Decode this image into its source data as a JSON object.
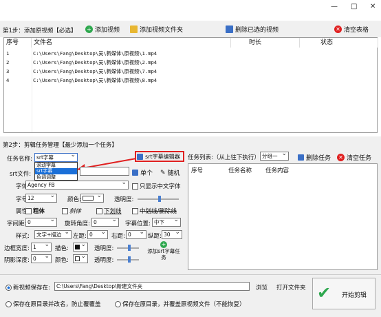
{
  "window": {
    "min": "—",
    "max": "□",
    "close": "✕"
  },
  "step1": {
    "title": "第1步：添加原视频【必选】",
    "add_video": "添加视频",
    "add_folder": "添加视频文件夹",
    "delete_selected": "删除已选的视频",
    "clear_table": "清空表格",
    "headers": [
      "序号",
      "文件名",
      "时长",
      "状态"
    ],
    "rows": [
      {
        "no": "1",
        "file": "C:\\Users\\Fang\\Desktop\\吴\\新媒体\\原视频\\1.mp4"
      },
      {
        "no": "2",
        "file": "C:\\Users\\Fang\\Desktop\\吴\\新媒体\\原视频\\2.mp4"
      },
      {
        "no": "3",
        "file": "C:\\Users\\Fang\\Desktop\\吴\\新媒体\\原视频\\7.mp4"
      },
      {
        "no": "4",
        "file": "C:\\Users\\Fang\\Desktop\\吴\\新媒体\\原视频\\8.mp4"
      }
    ]
  },
  "step2": {
    "title": "第2步：剪辑任务管理【最少添加一个任务】",
    "task_name_label": "任务名称:",
    "task_name_value": "srt字幕",
    "task_options": [
      "滚动字幕",
      "srt字幕",
      "色调调整"
    ],
    "srt_editor": "srt字幕编辑器",
    "srt_file_label": "srt文件:",
    "single": "单个",
    "random": "随机",
    "font_label": "字体:",
    "font_value": "Agency FB",
    "only_cn": "只显示中文字体",
    "size_label": "字号:",
    "size_value": "12",
    "color_label": "颜色:",
    "transparency_label": "透明度:",
    "attr_label": "属性:",
    "bold": "粗体",
    "italic": "斜体",
    "underline": "下划线",
    "strike": "中划线/删除线",
    "spacing_label": "字间距:",
    "spacing_value": "0",
    "rotate_label": "旋转角度:",
    "rotate_value": "0",
    "position_label": "字幕位置:",
    "position_value": "中下",
    "style_label": "样式:",
    "style_value": "文字+描边",
    "left_label": "左距:",
    "left_value": "0",
    "right_label": "右距:",
    "right_value": "0",
    "vert_label": "纵距:",
    "vert_value": "30",
    "border_label": "边框宽度:",
    "border_value": "1",
    "stroke_color_label": "描色:",
    "border_trans_label": "透明度:",
    "shadow_label": "阴影深度:",
    "shadow_value": "0",
    "shadow_color_label": "颜色:",
    "shadow_trans_label": "透明度:",
    "add_task": "添加srt字幕任务",
    "task_list_label": "任务列表:（从上往下执行）",
    "group_value": "分组一",
    "delete_task": "删除任务",
    "clear_task": "清空任务",
    "task_headers": [
      "序号",
      "任务名称",
      "任务内容"
    ]
  },
  "output": {
    "save_new_label": "新视频保存在:",
    "save_path": "C:\\Users\\Fang\\Desktop\\新建文件夹",
    "browse": "浏览",
    "open_folder": "打开文件夹",
    "opt_rename": "保存在原目录并改名，防止覆覆盖",
    "opt_overwrite": "保存在原目录，并覆盖原视频文件（不能恢复）",
    "start": "开始剪辑"
  },
  "colors": {
    "accent": "#1a6fd8",
    "red": "#e02020",
    "green": "#2fa84f"
  }
}
